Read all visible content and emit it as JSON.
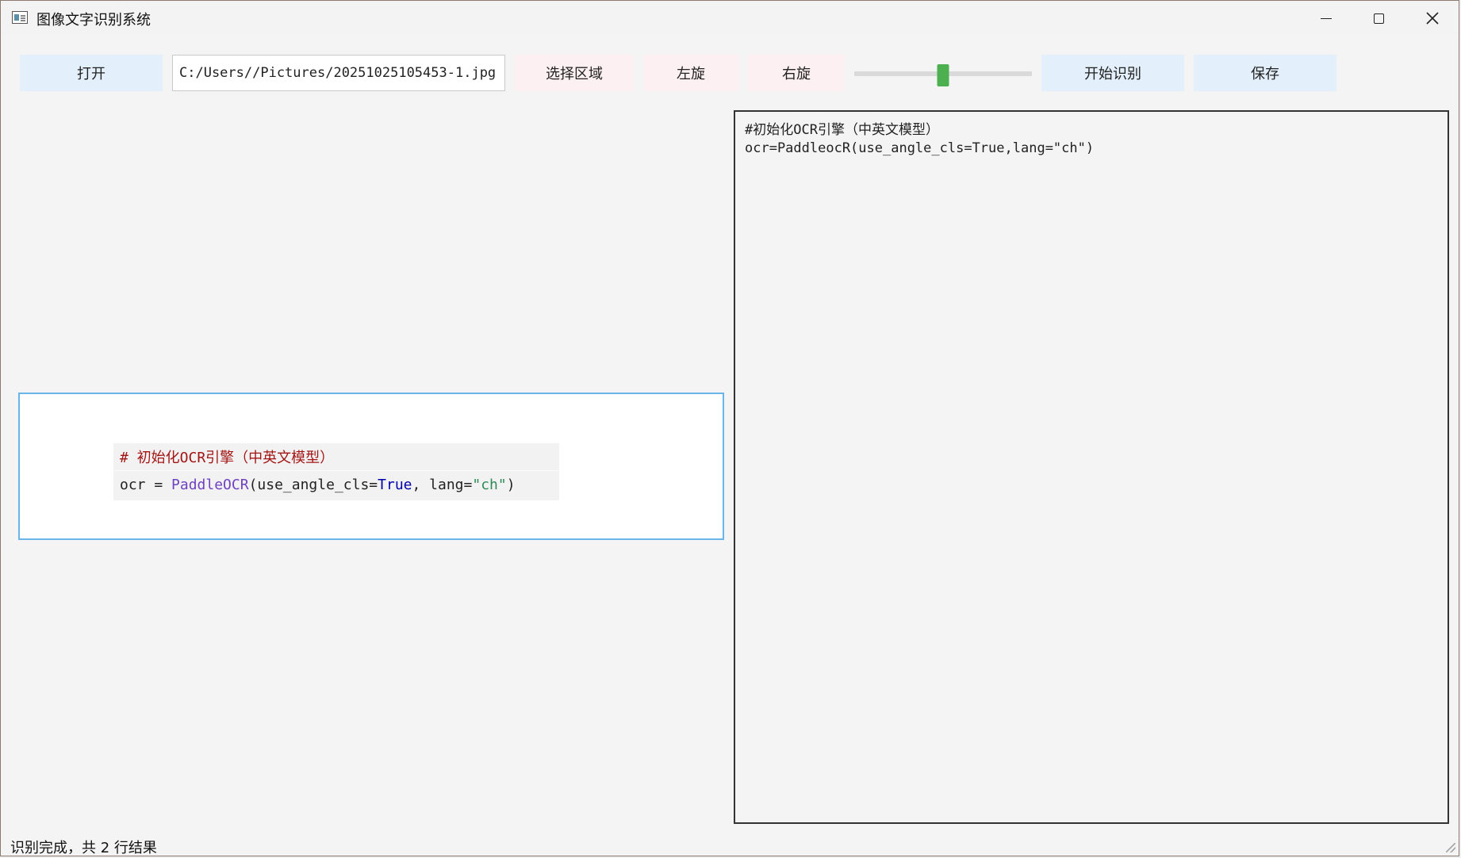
{
  "window": {
    "title": "图像文字识别系统"
  },
  "toolbar": {
    "open_label": "打开",
    "path_value": "C:/Users//Pictures/20251025105453-1.jpg",
    "select_region_label": "选择区域",
    "rotate_left_label": "左旋",
    "rotate_right_label": "右旋",
    "slider_value_fraction": 0.5,
    "start_ocr_label": "开始识别",
    "save_label": "保存"
  },
  "image_preview": {
    "line1": "# 初始化OCR引擎（中英文模型）",
    "line2_prefix": "ocr = ",
    "line2_fn": "PaddleOCR",
    "line2_mid": "(use_angle_cls=",
    "line2_kw": "True",
    "line2_mid2": ", lang=",
    "line2_str": "\"ch\"",
    "line2_end": ")"
  },
  "result": {
    "lines": [
      "#初始化OCR引擎（中英文模型）",
      "ocr=PaddleocR(use_angle_cls=True,lang=\"ch\")"
    ]
  },
  "status": {
    "text": "识别完成，共 2 行结果"
  },
  "colors": {
    "button_blue": "#e3f0fc",
    "button_pink": "#fdf0f3",
    "slider_handle": "#4caf50",
    "image_border": "#69b4e8"
  },
  "icons": {
    "app": "app-window-icon",
    "minimize": "minimize-icon",
    "maximize": "maximize-icon",
    "close": "close-icon"
  }
}
